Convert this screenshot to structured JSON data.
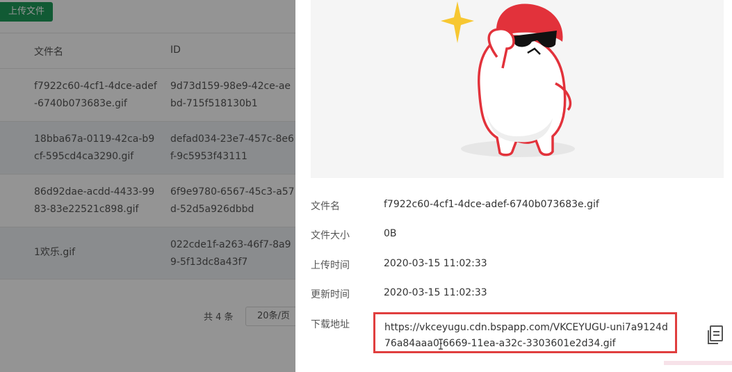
{
  "toolbar": {
    "upload_label": "上传文件"
  },
  "table": {
    "headers": [
      "文件名",
      "ID"
    ],
    "rows": [
      {
        "name": "f7922c60-4cf1-4dce-adef-6740b073683e.gif",
        "id": "9d73d159-98e9-42ce-aebd-715f518130b1"
      },
      {
        "name": "18bba67a-0119-42ca-b9cf-595cd4ca3290.gif",
        "id": "defad034-23e7-457c-8e6f-9c5953f43111"
      },
      {
        "name": "86d92dae-acdd-4433-9983-83e22521c898.gif",
        "id": "6f9e9780-6567-45c3-a57d-52d5a926dbbd"
      },
      {
        "name": "1欢乐.gif",
        "id": "022cde1f-a263-46f7-8a99-5f13dc8a43f7"
      }
    ]
  },
  "pagination": {
    "total": "共 4 条",
    "page_size": "20条/页"
  },
  "drawer": {
    "fields": {
      "filename_label": "文件名",
      "filename_value": "f7922c60-4cf1-4dce-adef-6740b073683e.gif",
      "size_label": "文件大小",
      "size_value": "0B",
      "upload_time_label": "上传时间",
      "upload_time_value": "2020-03-15 11:02:33",
      "update_time_label": "更新时间",
      "update_time_value": "2020-03-15 11:02:33",
      "download_label": "下载地址",
      "download_url": "https://vkceyugu.cdn.bspapp.com/VKCEYUGU-uni7a9124d76a84aaa0-6669-11ea-a32c-3303601e2d34.gif"
    },
    "icons": {
      "copy": "copy-icon",
      "sparkle": "sparkle-icon"
    }
  },
  "colors": {
    "primary": "#1e9b5b",
    "highlight_border": "#e03e3e",
    "mascot_red": "#e2323b"
  }
}
